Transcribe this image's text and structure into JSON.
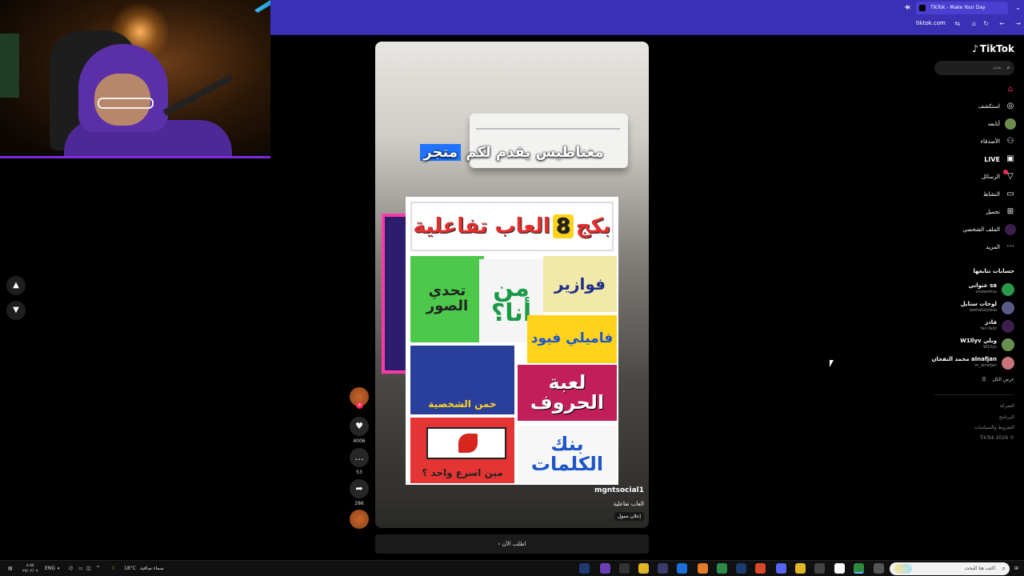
{
  "browser": {
    "tab_title": "TikTok - Make Your Day",
    "new_tab_icon": "plus-icon",
    "url": "tiktok.com",
    "accent_color": "#3a2fb5"
  },
  "video": {
    "caption_highlight": "متجر",
    "caption_rest": "مغناطيس يقدم لكم",
    "poster": {
      "title_part1": "بكج",
      "title_num": "8",
      "title_part2": "العاب تفاعلية",
      "cells": [
        "تحدي الصور",
        "من أنا؟",
        "فوازير",
        "فاميلي فيود",
        "خمن الشخصية",
        "لعبة الحروف",
        "مين اسرع واحد ؟",
        "بنك الكلمات"
      ]
    },
    "username": "mgntsocial1",
    "description": "العاب تفاعلية",
    "badge": "إعلان ممول",
    "cta": "اطلب الآن"
  },
  "actions": {
    "likes": "4006",
    "comments": "53",
    "shares": "286"
  },
  "sidebar": {
    "logo": "TikTok",
    "search_placeholder": "بحث",
    "nav": [
      {
        "label": "",
        "icon": "home-icon"
      },
      {
        "label": "استكشف",
        "icon": "compass-icon"
      },
      {
        "label": "أتابعه",
        "icon": "avatar-icon"
      },
      {
        "label": "الأصدقاء",
        "icon": "friends-icon"
      },
      {
        "label": "LIVE",
        "icon": "live-icon"
      },
      {
        "label": "الرسائل",
        "icon": "send-icon"
      },
      {
        "label": "النشاط",
        "icon": "message-icon"
      },
      {
        "label": "تحميل",
        "icon": "upload-icon"
      },
      {
        "label": "الملف الشخصي",
        "icon": "profile-icon"
      },
      {
        "label": "المزيد",
        "icon": "more-icon"
      }
    ],
    "following_title": "حسابات تتابعها",
    "accounts": [
      {
        "name": "عنواني sa",
        "handle": "onwaniksa",
        "color": "#2a9a4a"
      },
      {
        "name": "لوحات ستايل",
        "handle": "lawhatstylesa",
        "color": "#5a5a8a"
      },
      {
        "name": "فادز",
        "handle": "fan.fadz",
        "color": "#3a1f4a"
      },
      {
        "name": "W1llyv وبلي",
        "handle": "W1llyv",
        "color": "#6b8f4e"
      },
      {
        "name": "محمد النفجان alnafjan",
        "handle": "m_alnafjan",
        "color": "#c9737d"
      }
    ],
    "see_all": "عرض الكل",
    "footer": [
      "الشركة",
      "البرنامج",
      "الشروط والسياسات",
      "© 2026 TikTok"
    ]
  },
  "taskbar": {
    "time": "٨:٥٥",
    "date": "٢٧/٠٢/٠٩",
    "language": "ENG",
    "weather_temp": "18°C",
    "weather_desc": "سماء صافية",
    "search_placeholder": "اكتب هنا للبحث"
  }
}
